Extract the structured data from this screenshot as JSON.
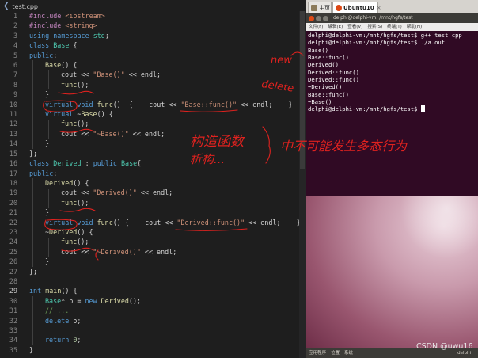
{
  "editor": {
    "tab_title": "test.cpp",
    "lines": [
      {
        "n": "1",
        "indent": 0,
        "tokens": [
          [
            "pp",
            "#include "
          ],
          [
            "inc",
            "<iostream>"
          ]
        ]
      },
      {
        "n": "2",
        "indent": 0,
        "tokens": [
          [
            "pp",
            "#include "
          ],
          [
            "inc",
            "<string>"
          ]
        ]
      },
      {
        "n": "3",
        "indent": 0,
        "tokens": [
          [
            "kw",
            "using"
          ],
          [
            "p",
            " "
          ],
          [
            "kw",
            "namespace"
          ],
          [
            "p",
            " "
          ],
          [
            "ty",
            "std"
          ],
          [
            "p",
            ";"
          ]
        ]
      },
      {
        "n": "4",
        "indent": 0,
        "tokens": [
          [
            "kw",
            "class"
          ],
          [
            "p",
            " "
          ],
          [
            "ty",
            "Base"
          ],
          [
            "p",
            " {"
          ]
        ]
      },
      {
        "n": "5",
        "indent": 0,
        "tokens": [
          [
            "kw",
            "public"
          ],
          [
            "p",
            ":"
          ]
        ]
      },
      {
        "n": "6",
        "indent": 1,
        "tokens": [
          [
            "fn",
            "Base"
          ],
          [
            "p",
            "() {"
          ]
        ]
      },
      {
        "n": "7",
        "indent": 2,
        "tokens": [
          [
            "p",
            "cout << "
          ],
          [
            "str",
            "\"Base()\""
          ],
          [
            "p",
            " << endl;"
          ]
        ]
      },
      {
        "n": "8",
        "indent": 2,
        "tokens": [
          [
            "fn",
            "func"
          ],
          [
            "p",
            "();"
          ]
        ]
      },
      {
        "n": "9",
        "indent": 1,
        "tokens": [
          [
            "p",
            "}"
          ]
        ]
      },
      {
        "n": "10",
        "indent": 1,
        "tokens": [
          [
            "kw",
            "virtual"
          ],
          [
            "p",
            " "
          ],
          [
            "kw",
            "void"
          ],
          [
            "p",
            " "
          ],
          [
            "fn",
            "func"
          ],
          [
            "p",
            "()  {    cout << "
          ],
          [
            "str",
            "\"Base::func()\""
          ],
          [
            "p",
            " << endl;    }"
          ]
        ]
      },
      {
        "n": "11",
        "indent": 1,
        "tokens": [
          [
            "kw",
            "virtual"
          ],
          [
            "p",
            " ~"
          ],
          [
            "fn",
            "Base"
          ],
          [
            "p",
            "() {"
          ]
        ]
      },
      {
        "n": "12",
        "indent": 2,
        "tokens": [
          [
            "fn",
            "func"
          ],
          [
            "p",
            "();"
          ]
        ]
      },
      {
        "n": "13",
        "indent": 2,
        "tokens": [
          [
            "p",
            "cout << "
          ],
          [
            "str",
            "\"~Base()\""
          ],
          [
            "p",
            " << endl;"
          ]
        ]
      },
      {
        "n": "14",
        "indent": 1,
        "tokens": [
          [
            "p",
            "}"
          ]
        ]
      },
      {
        "n": "15",
        "indent": 0,
        "tokens": [
          [
            "p",
            "};"
          ]
        ]
      },
      {
        "n": "16",
        "indent": 0,
        "tokens": [
          [
            "kw",
            "class"
          ],
          [
            "p",
            " "
          ],
          [
            "ty",
            "Derived"
          ],
          [
            "p",
            " : "
          ],
          [
            "kw",
            "public"
          ],
          [
            "p",
            " "
          ],
          [
            "ty",
            "Base"
          ],
          [
            "p",
            "{"
          ]
        ]
      },
      {
        "n": "17",
        "indent": 0,
        "tokens": [
          [
            "kw",
            "public"
          ],
          [
            "p",
            ":"
          ]
        ]
      },
      {
        "n": "18",
        "indent": 1,
        "tokens": [
          [
            "fn",
            "Derived"
          ],
          [
            "p",
            "() {"
          ]
        ]
      },
      {
        "n": "19",
        "indent": 2,
        "tokens": [
          [
            "p",
            "cout << "
          ],
          [
            "str",
            "\"Derived()\""
          ],
          [
            "p",
            " << endl;"
          ]
        ]
      },
      {
        "n": "20",
        "indent": 2,
        "tokens": [
          [
            "fn",
            "func"
          ],
          [
            "p",
            "();"
          ]
        ]
      },
      {
        "n": "21",
        "indent": 1,
        "tokens": [
          [
            "p",
            "}"
          ]
        ]
      },
      {
        "n": "22",
        "indent": 1,
        "tokens": [
          [
            "kw",
            "virtual"
          ],
          [
            "p",
            " "
          ],
          [
            "kw",
            "void"
          ],
          [
            "p",
            " "
          ],
          [
            "fn",
            "func"
          ],
          [
            "p",
            "() {    cout << "
          ],
          [
            "str",
            "\"Derived::func()\""
          ],
          [
            "p",
            " << endl;    }"
          ]
        ]
      },
      {
        "n": "23",
        "indent": 1,
        "tokens": [
          [
            "p",
            "~"
          ],
          [
            "fn",
            "Derived"
          ],
          [
            "p",
            "() {"
          ]
        ]
      },
      {
        "n": "24",
        "indent": 2,
        "tokens": [
          [
            "fn",
            "func"
          ],
          [
            "p",
            "();"
          ]
        ]
      },
      {
        "n": "25",
        "indent": 2,
        "tokens": [
          [
            "p",
            "cout << "
          ],
          [
            "str",
            "\"~Derived()\""
          ],
          [
            "p",
            " << endl;"
          ]
        ]
      },
      {
        "n": "26",
        "indent": 1,
        "tokens": [
          [
            "p",
            "}"
          ]
        ]
      },
      {
        "n": "27",
        "indent": 0,
        "tokens": [
          [
            "p",
            "};"
          ]
        ]
      },
      {
        "n": "28",
        "indent": 0,
        "tokens": []
      },
      {
        "n": "29",
        "indent": 0,
        "tokens": [
          [
            "kw",
            "int"
          ],
          [
            "p",
            " "
          ],
          [
            "fn",
            "main"
          ],
          [
            "p",
            "() {"
          ]
        ]
      },
      {
        "n": "30",
        "indent": 1,
        "tokens": [
          [
            "ty",
            "Base"
          ],
          [
            "p",
            "* p = "
          ],
          [
            "kw",
            "new"
          ],
          [
            "p",
            " "
          ],
          [
            "fn",
            "Derived"
          ],
          [
            "p",
            "();"
          ]
        ]
      },
      {
        "n": "31",
        "indent": 1,
        "tokens": [
          [
            "cm",
            "// ..."
          ]
        ]
      },
      {
        "n": "32",
        "indent": 1,
        "tokens": [
          [
            "kw",
            "delete"
          ],
          [
            "p",
            " p;"
          ]
        ]
      },
      {
        "n": "33",
        "indent": 0,
        "tokens": []
      },
      {
        "n": "34",
        "indent": 1,
        "tokens": [
          [
            "kw",
            "return"
          ],
          [
            "p",
            " "
          ],
          [
            "num",
            "0"
          ],
          [
            "p",
            ";"
          ]
        ]
      },
      {
        "n": "35",
        "indent": 0,
        "tokens": [
          [
            "p",
            "}"
          ]
        ]
      }
    ],
    "active_line": "29"
  },
  "vm": {
    "tabs": [
      {
        "label": "主页",
        "active": false
      },
      {
        "label": "Ubuntu10",
        "active": true
      }
    ],
    "tab_close": "×",
    "terminal_title": "delphi@delphi-vm: /mnt/hgfs/test",
    "menu": [
      "文件(F)",
      "编辑(E)",
      "查看(V)",
      "搜索(S)",
      "终端(T)",
      "帮助(H)"
    ],
    "terminal_lines": [
      "delphi@delphi-vm:/mnt/hgfs/test$ g++ test.cpp",
      "delphi@delphi-vm:/mnt/hgfs/test$ ./a.out",
      "Base()",
      "Base::func()",
      "Derived()",
      "Derived::func()",
      "Derived::func()",
      "~Derived()",
      "Base::func()",
      "~Base()"
    ],
    "prompt": "delphi@delphi-vm:/mnt/hgfs/test$ ",
    "taskbar": [
      "应用程序",
      "位置",
      "系统"
    ],
    "taskbar_right": "delphi"
  },
  "annotations": {
    "new_label": "new",
    "delete_label": "delete",
    "note_line1": "构造函数",
    "note_line2": "析构...",
    "note_conclusion": "中不可能发生多态行为"
  },
  "watermark": "CSDN @uwu16",
  "colors": {
    "editor_bg": "#1e1e1e",
    "keyword": "#569cd6",
    "string": "#ce9178",
    "function": "#dcdcaa",
    "type": "#4ec9b0",
    "terminal_bg": "#300a24",
    "ink": "#e0221f"
  }
}
